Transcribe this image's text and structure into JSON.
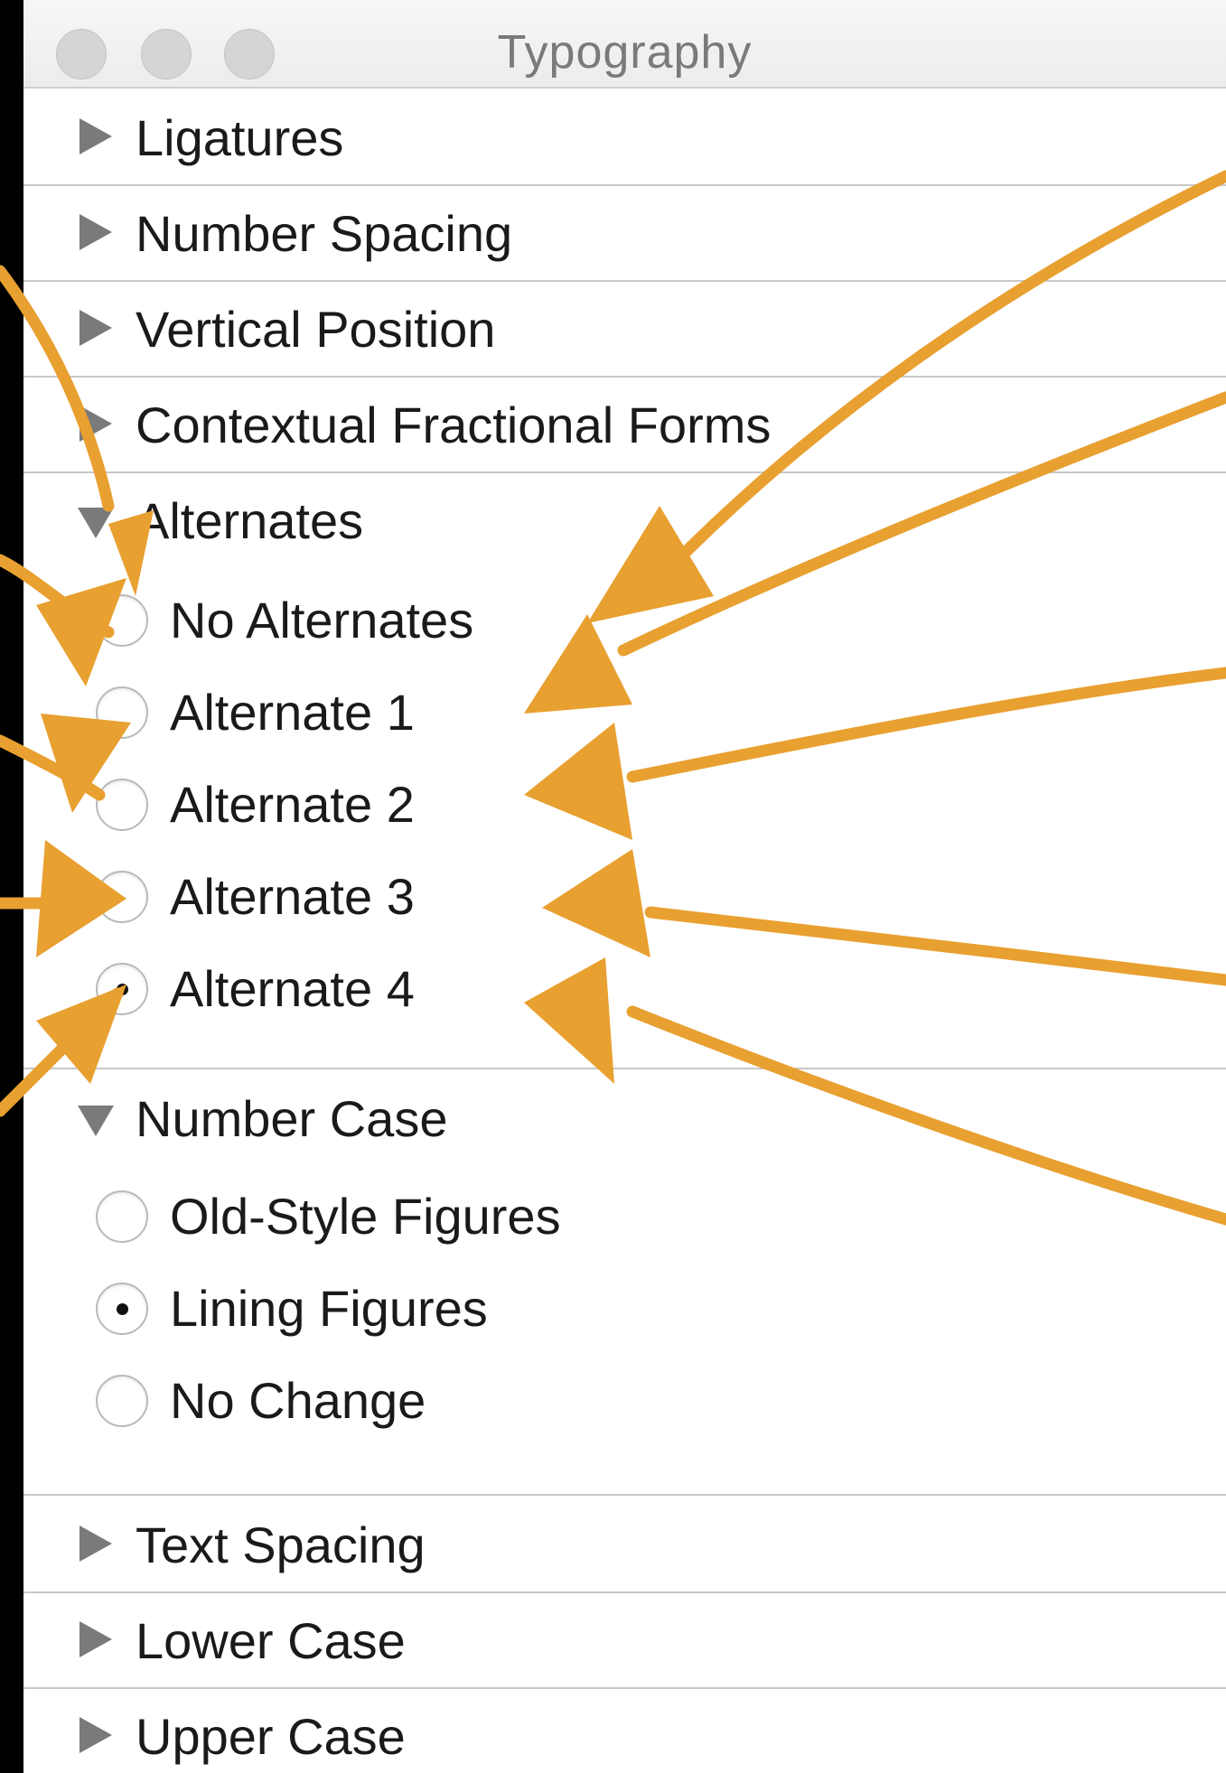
{
  "window": {
    "title": "Typography"
  },
  "sections_top": [
    {
      "label": "Ligatures",
      "expanded": false
    },
    {
      "label": "Number Spacing",
      "expanded": false
    },
    {
      "label": "Vertical Position",
      "expanded": false
    },
    {
      "label": "Contextual Fractional Forms",
      "expanded": false
    }
  ],
  "alternates": {
    "label": "Alternates",
    "expanded": true,
    "options": [
      {
        "label": "No Alternates",
        "checked": false
      },
      {
        "label": "Alternate 1",
        "checked": false
      },
      {
        "label": "Alternate 2",
        "checked": false
      },
      {
        "label": "Alternate 3",
        "checked": false
      },
      {
        "label": "Alternate 4",
        "checked": true
      }
    ]
  },
  "number_case": {
    "label": "Number Case",
    "expanded": true,
    "options": [
      {
        "label": "Old-Style Figures",
        "checked": false
      },
      {
        "label": "Lining Figures",
        "checked": true
      },
      {
        "label": "No Change",
        "checked": false
      }
    ]
  },
  "sections_bottom": [
    {
      "label": "Text Spacing",
      "expanded": false
    },
    {
      "label": "Lower Case",
      "expanded": false
    },
    {
      "label": "Upper Case",
      "expanded": false
    }
  ],
  "annotation_color": "#E8A030"
}
